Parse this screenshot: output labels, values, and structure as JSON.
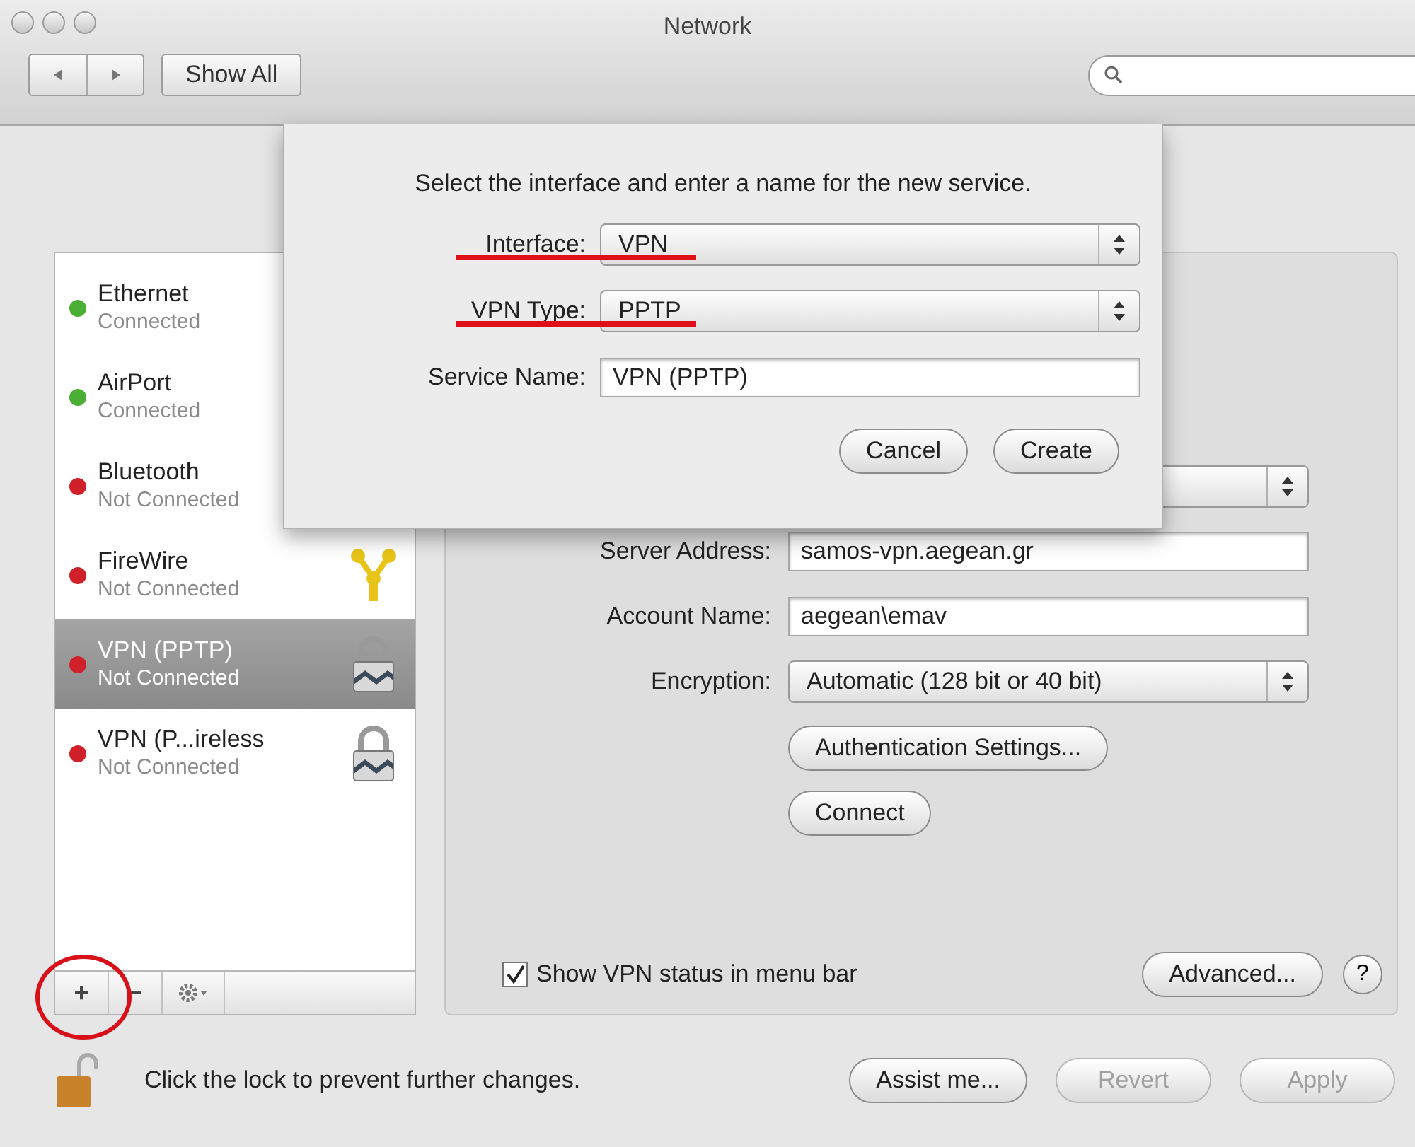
{
  "window": {
    "title": "Network"
  },
  "toolbar": {
    "show_all": "Show All"
  },
  "services": [
    {
      "name": "Ethernet",
      "status": "Connected",
      "color": "#4caf35",
      "selected": false,
      "kind": "ethernet"
    },
    {
      "name": "AirPort",
      "status": "Connected",
      "color": "#4caf35",
      "selected": false,
      "kind": "wifi"
    },
    {
      "name": "Bluetooth",
      "status": "Not Connected",
      "color": "#d0202a",
      "selected": false,
      "kind": "bluetooth"
    },
    {
      "name": "FireWire",
      "status": "Not Connected",
      "color": "#d0202a",
      "selected": false,
      "kind": "firewire"
    },
    {
      "name": "VPN (PPTP)",
      "status": "Not Connected",
      "color": "#d0202a",
      "selected": true,
      "kind": "vpn"
    },
    {
      "name": "VPN (P...ireless",
      "status": "Not Connected",
      "color": "#d0202a",
      "selected": false,
      "kind": "vpn"
    }
  ],
  "list_toolbar": {
    "add": "+",
    "remove": "−",
    "add_circled": true
  },
  "detail": {
    "fields": [
      {
        "kind": "text",
        "label": "Server Address:",
        "value": "samos-vpn.aegean.gr"
      },
      {
        "kind": "text",
        "label": "Account Name:",
        "value": "aegean\\emav"
      },
      {
        "kind": "popup",
        "label": "Encryption:",
        "value": "Automatic (128 bit or 40 bit)"
      }
    ],
    "buttons": [
      "Authentication Settings...",
      "Connect"
    ],
    "show_status": {
      "label": "Show VPN status in menu bar",
      "checked": true
    },
    "advanced": "Advanced...",
    "help": "?"
  },
  "footer": {
    "lock_text": "Click the lock to prevent further changes.",
    "buttons": [
      {
        "label": "Assist me...",
        "disabled": false
      },
      {
        "label": "Revert",
        "disabled": true
      },
      {
        "label": "Apply",
        "disabled": true
      }
    ]
  },
  "sheet": {
    "prompt": "Select the interface and enter a name for the new service.",
    "rows": [
      {
        "kind": "popup",
        "label": "Interface:",
        "value": "VPN",
        "underlined": true
      },
      {
        "kind": "popup",
        "label": "VPN Type:",
        "value": "PPTP",
        "underlined": true
      },
      {
        "kind": "text",
        "label": "Service Name:",
        "value": "VPN (PPTP)",
        "underlined": false
      }
    ],
    "buttons": [
      "Cancel",
      "Create"
    ]
  }
}
